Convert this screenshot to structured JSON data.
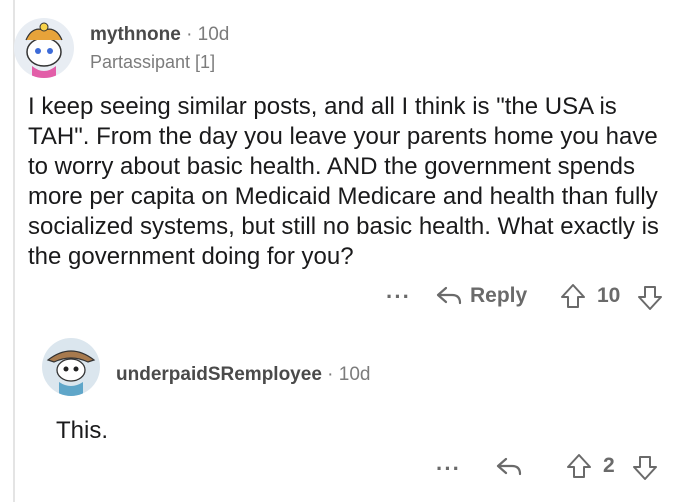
{
  "comment1": {
    "username": "mythnone",
    "separator": "·",
    "age": "10d",
    "flair": "Partassipant [1]",
    "body": "I keep seeing similar posts, and all I think is \"the USA is TAH\".  From the day you leave your parents home you have to worry about basic health.  AND the government spends more per capita on Medicaid Medicare and health than fully socialized systems, but still no basic health.  What exactly is the government doing for you?",
    "more_label": "···",
    "reply_label": "Reply",
    "score": "10"
  },
  "comment2": {
    "username": "underpaidSRemployee",
    "separator": "·",
    "age": "10d",
    "body": "This.",
    "more_label": "···",
    "score": "2"
  },
  "colors": {
    "text": "#1a1a1b",
    "meta": "#7c7c7c",
    "action": "#6a6a6a",
    "divider": "#e4e4e4",
    "avatar1_bg": "#e8edf3",
    "avatar2_bg": "#dbe6ee"
  },
  "icons": [
    "reddit-avatar",
    "reply-arrow-icon",
    "upvote-icon",
    "downvote-icon",
    "more-dots-icon"
  ]
}
